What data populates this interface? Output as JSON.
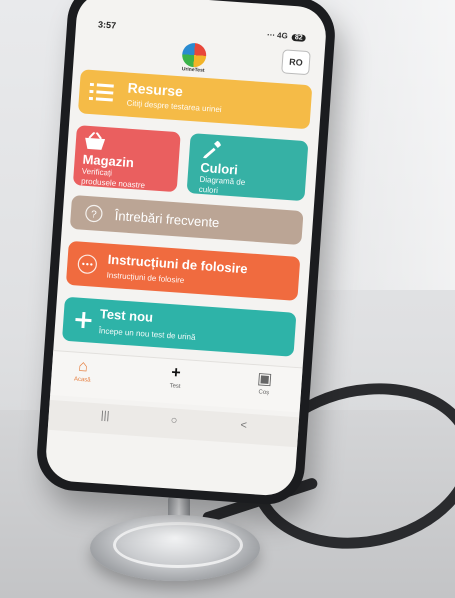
{
  "status_bar": {
    "time": "3:57",
    "icons": "⋯ 4G",
    "battery": "82"
  },
  "header": {
    "logo_text": "UrineTest",
    "language_button": "RO"
  },
  "cards": {
    "resurse": {
      "title": "Resurse",
      "subtitle": "Citiți despre testarea urinei"
    },
    "magazin": {
      "title": "Magazin",
      "subtitle_line1": "Verificați",
      "subtitle_line2": "produsele noastre"
    },
    "culori": {
      "title": "Culori",
      "subtitle_line1": "Diagramă de",
      "subtitle_line2": "culori"
    },
    "faq": {
      "title": "Întrebări frecvente"
    },
    "instructiuni": {
      "title": "Instrucțiuni de folosire",
      "subtitle": "Instrucțiuni de folosire"
    },
    "test_nou": {
      "title": "Test nou",
      "subtitle": "Începe un nou test de urină"
    }
  },
  "bottom_nav": [
    {
      "label": "Acasă",
      "icon": "home-icon",
      "active": true
    },
    {
      "label": "Test",
      "icon": "plus-icon",
      "active": false
    },
    {
      "label": "Coș",
      "icon": "cart-icon",
      "active": false
    }
  ],
  "system_nav": {
    "recent": "|||",
    "home": "○",
    "back": "<"
  },
  "colors": {
    "resurse": "#f5bb47",
    "magazin": "#ea5f5f",
    "culori": "#36b1a5",
    "faq": "#bba595",
    "instructiuni": "#f06b3f",
    "test_nou": "#2eb3a8",
    "accent": "#e67e3e"
  }
}
